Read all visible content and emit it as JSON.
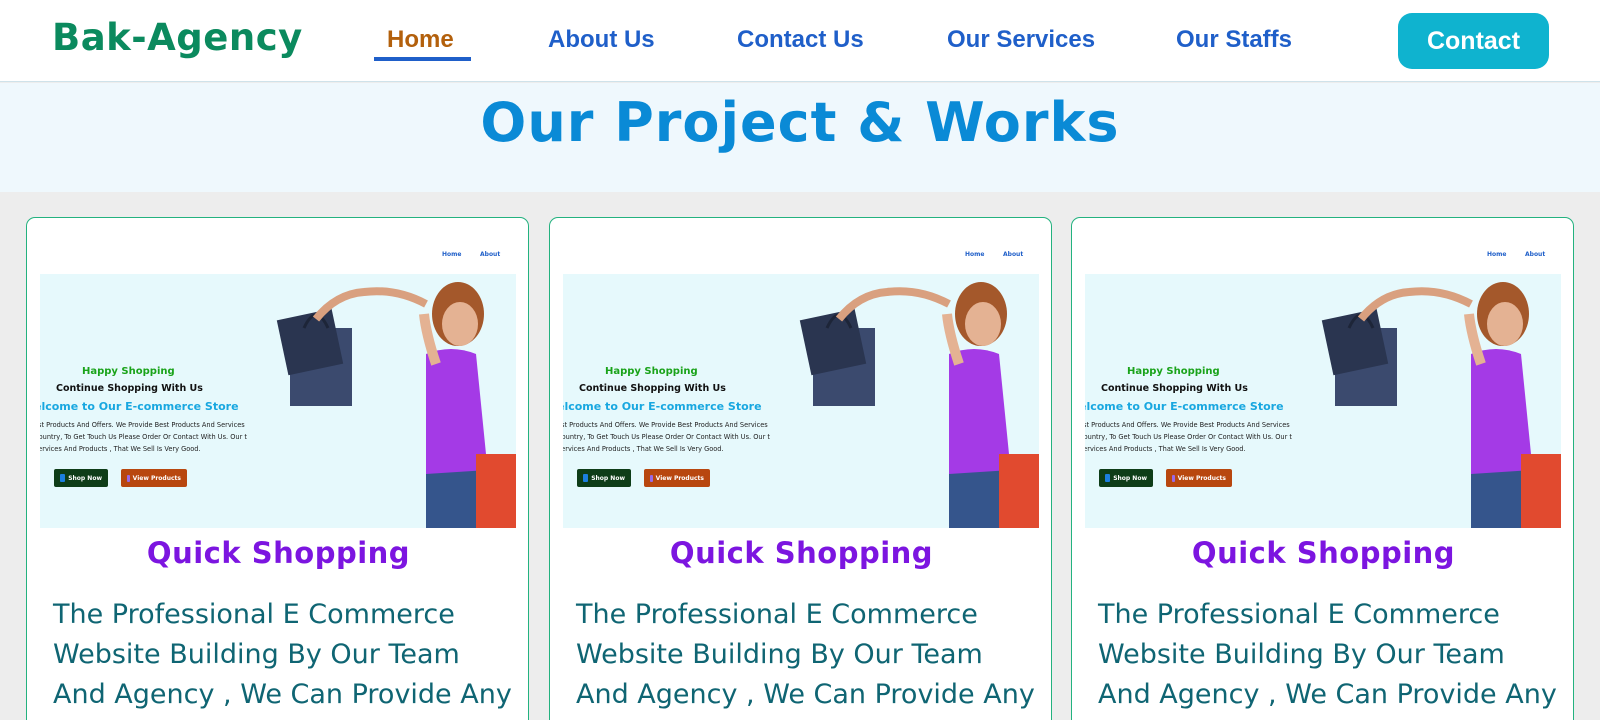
{
  "header": {
    "logo": "Bak-Agency",
    "nav": [
      {
        "label": "Home",
        "active": true
      },
      {
        "label": "About Us",
        "active": false
      },
      {
        "label": "Contact Us",
        "active": false
      },
      {
        "label": "Our Services",
        "active": false
      },
      {
        "label": "Our Staffs",
        "active": false
      }
    ],
    "contact_button": "Contact"
  },
  "section": {
    "title": "Our Project & Works"
  },
  "cards": [
    {
      "preview": {
        "nav": [
          "Home",
          "About"
        ],
        "happy": "Happy Shopping",
        "continue": "Continue Shopping With Us",
        "welcome": "elcome to Our E-commerce Store",
        "description": "est Products And Offers. We Provide Best Products And Services Country, To Get Touch Us Please Order Or Contact With Us. Our t Services And Products , That We Sell Is Very Good.",
        "shop_button": "Shop Now",
        "view_button": "View Products",
        "shop_icon": "shopping-bag-icon",
        "view_icon": "cart-icon"
      },
      "title": "Quick Shopping",
      "description": "The Professional E Commerce Website Building By Our Team And Agency , We Can Provide Any"
    },
    {
      "preview": {
        "nav": [
          "Home",
          "About"
        ],
        "happy": "Happy Shopping",
        "continue": "Continue Shopping With Us",
        "welcome": "elcome to Our E-commerce Store",
        "description": "est Products And Offers. We Provide Best Products And Services Country, To Get Touch Us Please Order Or Contact With Us. Our t Services And Products , That We Sell Is Very Good.",
        "shop_button": "Shop Now",
        "view_button": "View Products",
        "shop_icon": "shopping-bag-icon",
        "view_icon": "cart-icon"
      },
      "title": "Quick Shopping",
      "description": "The Professional E Commerce Website Building By Our Team And Agency , We Can Provide Any"
    },
    {
      "preview": {
        "nav": [
          "Home",
          "About"
        ],
        "happy": "Happy Shopping",
        "continue": "Continue Shopping With Us",
        "welcome": "elcome to Our E-commerce Store",
        "description": "est Products And Offers. We Provide Best Products And Services Country, To Get Touch Us Please Order Or Contact With Us. Our t Services And Products , That We Sell Is Very Good.",
        "shop_button": "Shop Now",
        "view_button": "View Products",
        "shop_icon": "shopping-bag-icon",
        "view_icon": "cart-icon"
      },
      "title": "Quick Shopping",
      "description": "The Professional E Commerce Website Building By Our Team And Agency , We Can Provide Any"
    }
  ],
  "colors": {
    "logo": "#0b8a5e",
    "nav_link": "#1f5fc9",
    "nav_active": "#b3600c",
    "contact_button": "#0fb3cf",
    "section_title": "#0a8ad6",
    "card_title": "#7c15e0",
    "card_text": "#0f6573",
    "card_border": "#23b27f"
  }
}
